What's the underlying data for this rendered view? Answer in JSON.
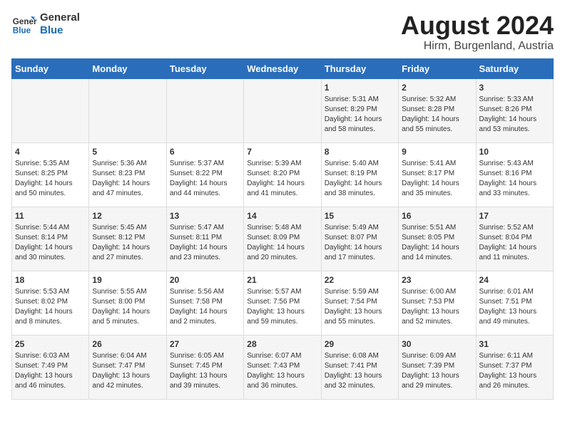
{
  "logo": {
    "line1": "General",
    "line2": "Blue"
  },
  "title": "August 2024",
  "subtitle": "Hirm, Burgenland, Austria",
  "weekdays": [
    "Sunday",
    "Monday",
    "Tuesday",
    "Wednesday",
    "Thursday",
    "Friday",
    "Saturday"
  ],
  "weeks": [
    [
      {
        "day": "",
        "info": ""
      },
      {
        "day": "",
        "info": ""
      },
      {
        "day": "",
        "info": ""
      },
      {
        "day": "",
        "info": ""
      },
      {
        "day": "1",
        "info": "Sunrise: 5:31 AM\nSunset: 8:29 PM\nDaylight: 14 hours\nand 58 minutes."
      },
      {
        "day": "2",
        "info": "Sunrise: 5:32 AM\nSunset: 8:28 PM\nDaylight: 14 hours\nand 55 minutes."
      },
      {
        "day": "3",
        "info": "Sunrise: 5:33 AM\nSunset: 8:26 PM\nDaylight: 14 hours\nand 53 minutes."
      }
    ],
    [
      {
        "day": "4",
        "info": "Sunrise: 5:35 AM\nSunset: 8:25 PM\nDaylight: 14 hours\nand 50 minutes."
      },
      {
        "day": "5",
        "info": "Sunrise: 5:36 AM\nSunset: 8:23 PM\nDaylight: 14 hours\nand 47 minutes."
      },
      {
        "day": "6",
        "info": "Sunrise: 5:37 AM\nSunset: 8:22 PM\nDaylight: 14 hours\nand 44 minutes."
      },
      {
        "day": "7",
        "info": "Sunrise: 5:39 AM\nSunset: 8:20 PM\nDaylight: 14 hours\nand 41 minutes."
      },
      {
        "day": "8",
        "info": "Sunrise: 5:40 AM\nSunset: 8:19 PM\nDaylight: 14 hours\nand 38 minutes."
      },
      {
        "day": "9",
        "info": "Sunrise: 5:41 AM\nSunset: 8:17 PM\nDaylight: 14 hours\nand 35 minutes."
      },
      {
        "day": "10",
        "info": "Sunrise: 5:43 AM\nSunset: 8:16 PM\nDaylight: 14 hours\nand 33 minutes."
      }
    ],
    [
      {
        "day": "11",
        "info": "Sunrise: 5:44 AM\nSunset: 8:14 PM\nDaylight: 14 hours\nand 30 minutes."
      },
      {
        "day": "12",
        "info": "Sunrise: 5:45 AM\nSunset: 8:12 PM\nDaylight: 14 hours\nand 27 minutes."
      },
      {
        "day": "13",
        "info": "Sunrise: 5:47 AM\nSunset: 8:11 PM\nDaylight: 14 hours\nand 23 minutes."
      },
      {
        "day": "14",
        "info": "Sunrise: 5:48 AM\nSunset: 8:09 PM\nDaylight: 14 hours\nand 20 minutes."
      },
      {
        "day": "15",
        "info": "Sunrise: 5:49 AM\nSunset: 8:07 PM\nDaylight: 14 hours\nand 17 minutes."
      },
      {
        "day": "16",
        "info": "Sunrise: 5:51 AM\nSunset: 8:05 PM\nDaylight: 14 hours\nand 14 minutes."
      },
      {
        "day": "17",
        "info": "Sunrise: 5:52 AM\nSunset: 8:04 PM\nDaylight: 14 hours\nand 11 minutes."
      }
    ],
    [
      {
        "day": "18",
        "info": "Sunrise: 5:53 AM\nSunset: 8:02 PM\nDaylight: 14 hours\nand 8 minutes."
      },
      {
        "day": "19",
        "info": "Sunrise: 5:55 AM\nSunset: 8:00 PM\nDaylight: 14 hours\nand 5 minutes."
      },
      {
        "day": "20",
        "info": "Sunrise: 5:56 AM\nSunset: 7:58 PM\nDaylight: 14 hours\nand 2 minutes."
      },
      {
        "day": "21",
        "info": "Sunrise: 5:57 AM\nSunset: 7:56 PM\nDaylight: 13 hours\nand 59 minutes."
      },
      {
        "day": "22",
        "info": "Sunrise: 5:59 AM\nSunset: 7:54 PM\nDaylight: 13 hours\nand 55 minutes."
      },
      {
        "day": "23",
        "info": "Sunrise: 6:00 AM\nSunset: 7:53 PM\nDaylight: 13 hours\nand 52 minutes."
      },
      {
        "day": "24",
        "info": "Sunrise: 6:01 AM\nSunset: 7:51 PM\nDaylight: 13 hours\nand 49 minutes."
      }
    ],
    [
      {
        "day": "25",
        "info": "Sunrise: 6:03 AM\nSunset: 7:49 PM\nDaylight: 13 hours\nand 46 minutes."
      },
      {
        "day": "26",
        "info": "Sunrise: 6:04 AM\nSunset: 7:47 PM\nDaylight: 13 hours\nand 42 minutes."
      },
      {
        "day": "27",
        "info": "Sunrise: 6:05 AM\nSunset: 7:45 PM\nDaylight: 13 hours\nand 39 minutes."
      },
      {
        "day": "28",
        "info": "Sunrise: 6:07 AM\nSunset: 7:43 PM\nDaylight: 13 hours\nand 36 minutes."
      },
      {
        "day": "29",
        "info": "Sunrise: 6:08 AM\nSunset: 7:41 PM\nDaylight: 13 hours\nand 32 minutes."
      },
      {
        "day": "30",
        "info": "Sunrise: 6:09 AM\nSunset: 7:39 PM\nDaylight: 13 hours\nand 29 minutes."
      },
      {
        "day": "31",
        "info": "Sunrise: 6:11 AM\nSunset: 7:37 PM\nDaylight: 13 hours\nand 26 minutes."
      }
    ]
  ]
}
